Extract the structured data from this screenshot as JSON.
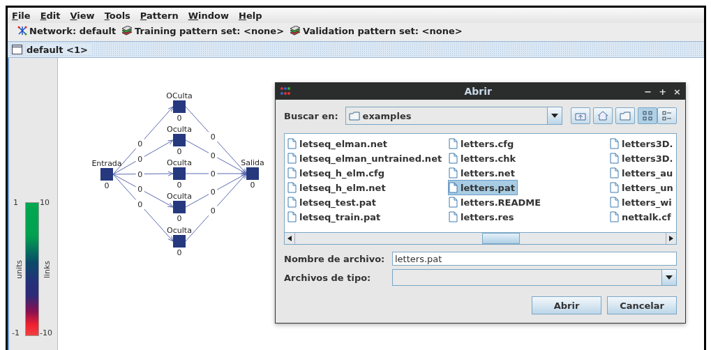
{
  "menu": [
    {
      "label": "File"
    },
    {
      "label": "Edit"
    },
    {
      "label": "View"
    },
    {
      "label": "Tools"
    },
    {
      "label": "Pattern"
    },
    {
      "label": "Window"
    },
    {
      "label": "Help"
    }
  ],
  "toolbar": [
    {
      "kind": "network",
      "label": "Network: default"
    },
    {
      "kind": "patterns",
      "label": "Training pattern set: <none>"
    },
    {
      "kind": "patterns",
      "label": "Validation pattern set: <none>"
    }
  ],
  "frame": {
    "title": "default <1>"
  },
  "legend": {
    "units_max": "1",
    "units_min": "-1",
    "links_max": "10",
    "links_min": "-10",
    "units_label": "units",
    "links_label": "links"
  },
  "network": {
    "nodes": [
      {
        "label": "Entrada",
        "value": "0"
      },
      {
        "label": "OCulta",
        "value": "0"
      },
      {
        "label": "Oculta",
        "value": "0"
      },
      {
        "label": "Oculta",
        "value": "0"
      },
      {
        "label": "Oculta",
        "value": "0"
      },
      {
        "label": "Oculta",
        "value": "0"
      },
      {
        "label": "Salida",
        "value": "0"
      }
    ],
    "input_links": [
      "0",
      "0",
      "0",
      "0",
      "0"
    ],
    "output_links": [
      "0",
      "0",
      "0",
      "0",
      "0"
    ]
  },
  "dialog": {
    "title": "Abrir",
    "controls": [
      "−",
      "+",
      "×"
    ],
    "look_in": {
      "label": "Buscar en:",
      "value": "examples"
    },
    "files": [
      [
        {
          "name": "letseq_elman.net",
          "selected": false
        },
        {
          "name": "letseq_elman_untrained.net",
          "selected": false
        },
        {
          "name": "letseq_h_elm.cfg",
          "selected": false
        },
        {
          "name": "letseq_h_elm.net",
          "selected": false
        },
        {
          "name": "letseq_test.pat",
          "selected": false
        },
        {
          "name": "letseq_train.pat",
          "selected": false
        }
      ],
      [
        {
          "name": "letters.cfg",
          "selected": false
        },
        {
          "name": "letters.chk",
          "selected": false
        },
        {
          "name": "letters.net",
          "selected": false
        },
        {
          "name": "letters.pat",
          "selected": true
        },
        {
          "name": "letters.README",
          "selected": false
        },
        {
          "name": "letters.res",
          "selected": false
        }
      ],
      [
        {
          "name": "letters3D.",
          "selected": false
        },
        {
          "name": "letters3D.",
          "selected": false
        },
        {
          "name": "letters_au",
          "selected": false
        },
        {
          "name": "letters_un",
          "selected": false
        },
        {
          "name": "letters_wi",
          "selected": false
        },
        {
          "name": "nettalk.cf",
          "selected": false
        }
      ]
    ],
    "filename": {
      "label": "Nombre de archivo:",
      "value": "letters.pat"
    },
    "filetype": {
      "label": "Archivos de tipo:"
    },
    "buttons": [
      "Abrir",
      "Cancelar"
    ]
  }
}
